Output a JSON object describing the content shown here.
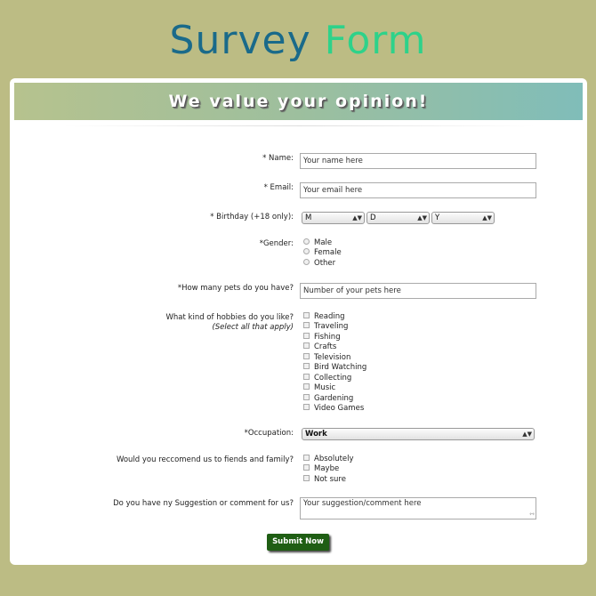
{
  "page": {
    "title_part1": "Survey",
    "title_part2": "Form",
    "banner": "We value your opinion!"
  },
  "form": {
    "name": {
      "label": "* Name:",
      "placeholder": "Your name here"
    },
    "email": {
      "label": "* Email:",
      "placeholder": "Your email here"
    },
    "birthday": {
      "label": "* Birthday (+18 only):",
      "month": "M",
      "day": "D",
      "year": "Y"
    },
    "gender": {
      "label": "*Gender:",
      "options": [
        "Male",
        "Female",
        "Other"
      ]
    },
    "pets": {
      "label": "*How many pets do you have?",
      "placeholder": "Number of your pets here"
    },
    "hobbies": {
      "label": "What kind of hobbies do you like?",
      "hint": "(Select all that apply)",
      "options": [
        "Reading",
        "Traveling",
        "Fishing",
        "Crafts",
        "Television",
        "Bird Watching",
        "Collecting",
        "Music",
        "Gardening",
        "Video Games"
      ]
    },
    "occupation": {
      "label": "*Occupation:",
      "value": "Work"
    },
    "recommend": {
      "label": "Would you reccomend us to fiends and family?",
      "options": [
        "Absolutely",
        "Maybe",
        "Not sure"
      ]
    },
    "suggestion": {
      "label": "Do you have ny Suggestion or comment for us?",
      "placeholder": "Your suggestion/comment here"
    },
    "submit_label": "Submit Now"
  }
}
